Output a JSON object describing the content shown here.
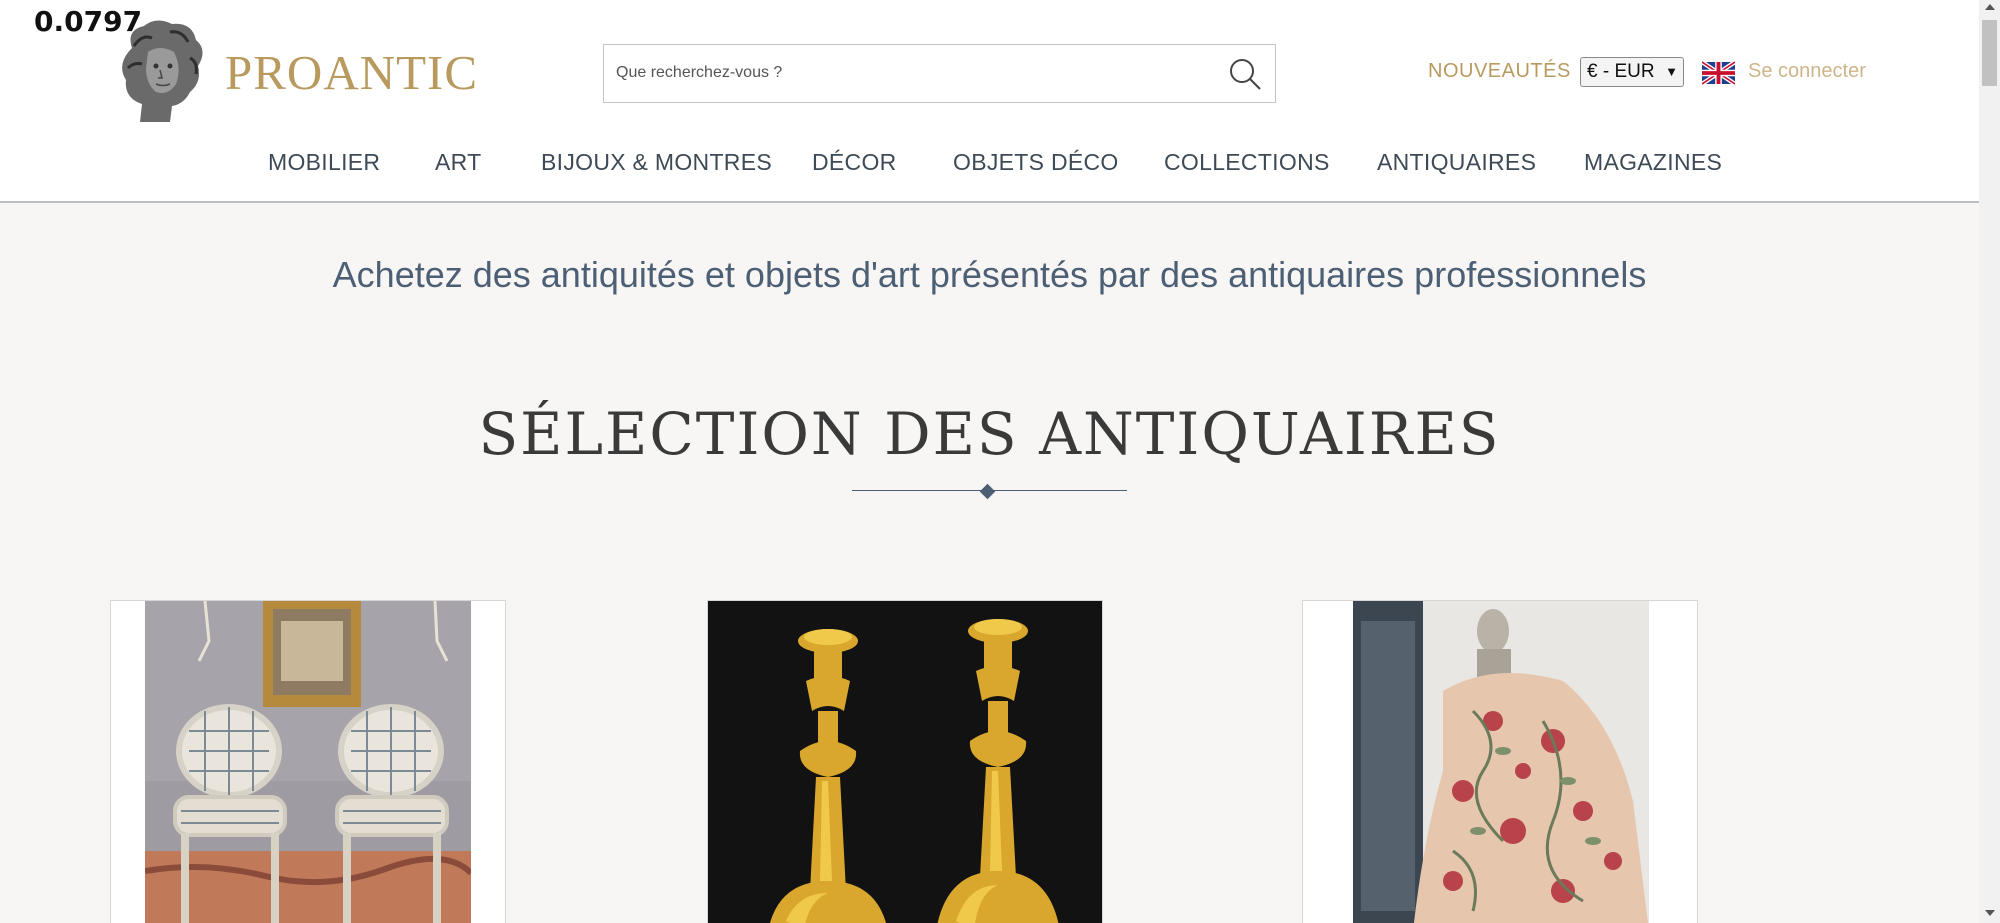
{
  "overlay": {
    "value": "0.0797"
  },
  "brand": {
    "name": "PROANTIC",
    "logo_icon": "classical-bust-icon"
  },
  "search": {
    "placeholder": "Que recherchez-vous ?",
    "icon": "search-icon"
  },
  "header_links": {
    "nouveautes": "NOUVEAUTÉS",
    "currency": "€ - EUR",
    "language_flag_icon": "uk-flag-icon",
    "login": "Se connecter"
  },
  "nav": {
    "items": [
      {
        "label": "MOBILIER"
      },
      {
        "label": "ART"
      },
      {
        "label": "BIJOUX & MONTRES"
      },
      {
        "label": "DÉCOR"
      },
      {
        "label": "OBJETS DÉCO"
      },
      {
        "label": "COLLECTIONS"
      },
      {
        "label": "ANTIQUAIRES"
      },
      {
        "label": "MAGAZINES"
      }
    ]
  },
  "main": {
    "tagline": "Achetez des antiquités et objets d'art présentés par des antiquaires professionnels",
    "section_title": "SÉLECTION DES ANTIQUAIRES"
  },
  "colors": {
    "gold": "#b89a5f",
    "slate_blue": "#4c5f75",
    "background": "#f7f6f4"
  }
}
